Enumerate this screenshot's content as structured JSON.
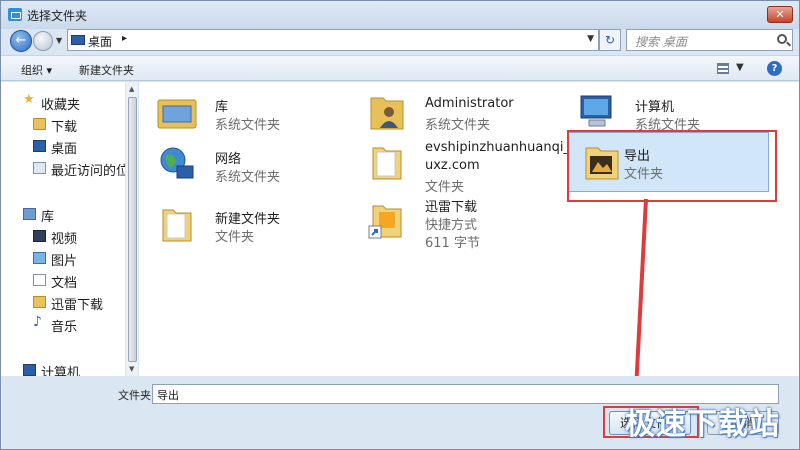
{
  "window": {
    "title": "选择文件夹",
    "close_label": "✕"
  },
  "nav": {
    "address": "桌面",
    "address_chevron": "▸",
    "search_placeholder": "搜索 桌面"
  },
  "toolbar": {
    "organize": "组织 ▾",
    "new_folder": "新建文件夹",
    "help": "?"
  },
  "sidebar": {
    "items": [
      {
        "label": "收藏夹",
        "icon": "star-icon"
      },
      {
        "label": "下载",
        "icon": "folder-icon"
      },
      {
        "label": "桌面",
        "icon": "desktop-icon"
      },
      {
        "label": "最近访问的位",
        "icon": "recent-places-icon"
      },
      {
        "label": "库",
        "icon": "library-icon"
      },
      {
        "label": "视频",
        "icon": "video-icon"
      },
      {
        "label": "图片",
        "icon": "pictures-icon"
      },
      {
        "label": "文档",
        "icon": "documents-icon"
      },
      {
        "label": "迅雷下载",
        "icon": "thunder-folder-icon"
      },
      {
        "label": "音乐",
        "icon": "music-icon"
      },
      {
        "label": "计算机",
        "icon": "computer-icon"
      }
    ]
  },
  "files": [
    {
      "name": "库",
      "type": "系统文件夹",
      "icon": "library-icon"
    },
    {
      "name": "Administrator",
      "type": "系统文件夹",
      "icon": "user-folder-icon"
    },
    {
      "name": "计算机",
      "type": "系统文件夹",
      "icon": "computer-icon"
    },
    {
      "name": "网络",
      "type": "系统文件夹",
      "icon": "network-icon"
    },
    {
      "name": "evshipinzhuanhuanqi_Jis",
      "name2": "uxz.com",
      "type": "文件夹",
      "icon": "folder-icon"
    },
    {
      "name": "导出",
      "type": "文件夹",
      "icon": "folder-icon",
      "selected": true
    },
    {
      "name": "新建文件夹",
      "type": "文件夹",
      "icon": "folder-icon"
    },
    {
      "name": "迅雷下载",
      "type": "快捷方式",
      "size": "611 字节",
      "icon": "shortcut-folder-icon"
    }
  ],
  "bottom": {
    "folder_label": "文件夹:",
    "folder_value": "导出",
    "ok_label": "选择文件夹",
    "cancel_label": "取消"
  },
  "watermark": "极速下载站",
  "colors": {
    "highlight": "#e03b3b",
    "selection": "#d2e6fa"
  }
}
